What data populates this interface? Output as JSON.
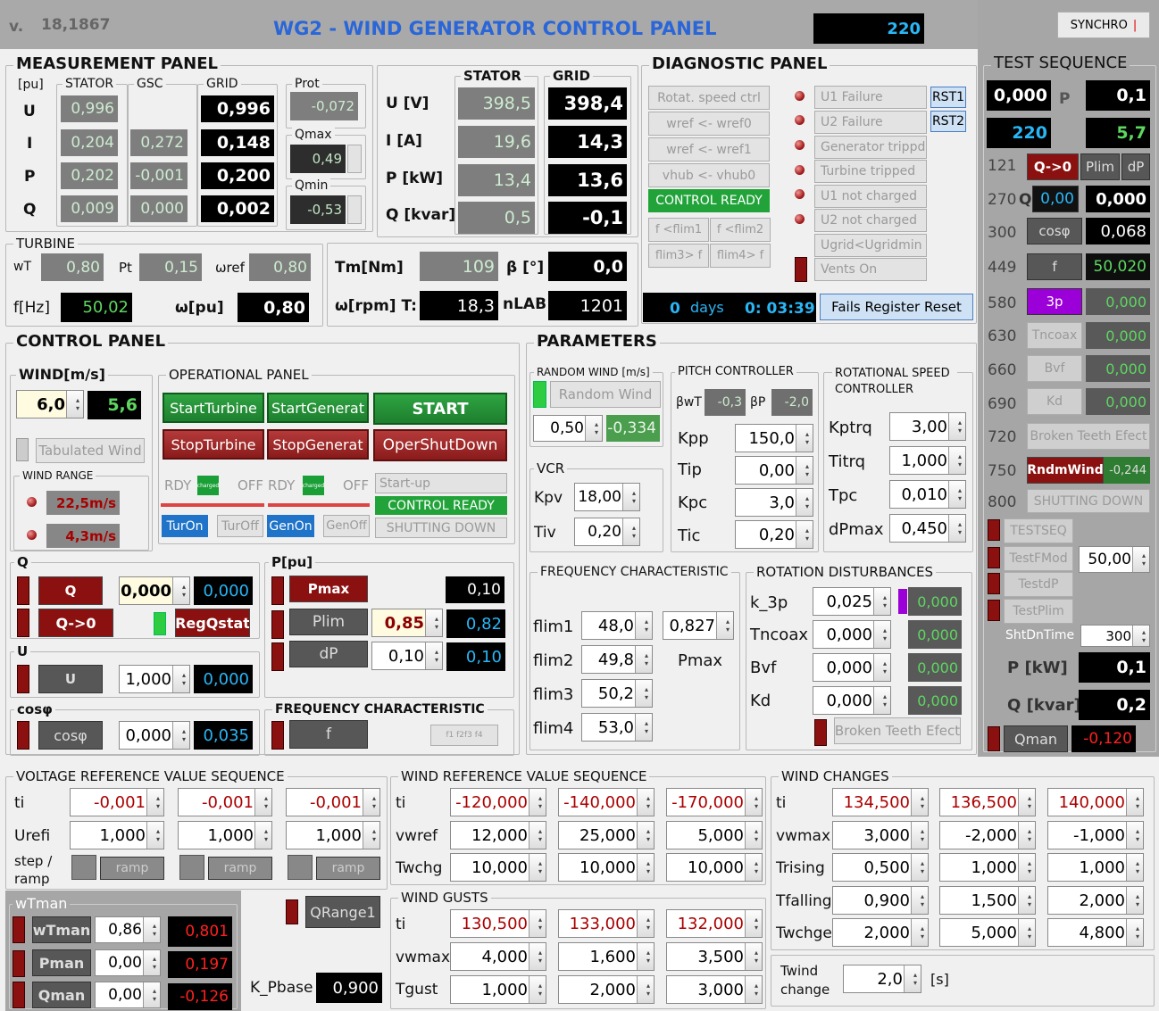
{
  "header": {
    "version": "v.",
    "version_num": "18,1867",
    "title": "WG2 - WIND GENERATOR CONTROL PANEL",
    "value": "220",
    "synchro": "SYNCHRO"
  },
  "meas": {
    "title": "MEASUREMENT PANEL",
    "pu": "[pu]",
    "stator": "STATOR",
    "gsc": "GSC",
    "grid": "GRID",
    "rows": [
      "U",
      "I",
      "P",
      "Q"
    ],
    "stator_vals": [
      "0,996",
      "0,204",
      "0,202",
      "0,009"
    ],
    "gsc_vals": [
      "",
      "0,272",
      "-0,001",
      "0,000"
    ],
    "grid_vals": [
      "0,996",
      "0,148",
      "0,200",
      "0,002"
    ],
    "prot": "Prot",
    "prot_val": "-0,072",
    "qmax": "Qmax",
    "qmax_val": "0,49",
    "qmin": "Qmin",
    "qmin_val": "-0,53"
  },
  "meas2": {
    "stator": "STATOR",
    "grid": "GRID",
    "labels": [
      "U [V]",
      "I [A]",
      "P [kW]",
      "Q [kvar]"
    ],
    "stator_vals": [
      "398,5",
      "19,6",
      "13,4",
      "0,5"
    ],
    "grid_vals": [
      "398,4",
      "14,3",
      "13,6",
      "-0,1"
    ]
  },
  "turbine": {
    "title": "TURBINE",
    "wt": "wT",
    "wt_val": "0,80",
    "pt": "Pt",
    "pt_val": "0,15",
    "wref": "ωref",
    "wref_val": "0,80",
    "fhz": "f[Hz]",
    "fhz_val": "50,02",
    "wpu": "ω[pu]",
    "wpu_val": "0,80",
    "tm": "Tm[Nm]",
    "tm_val": "109",
    "beta": "β [°]",
    "beta_val": "0,0",
    "wrpm": "ω[rpm] T:",
    "wrpm_val": "18,3",
    "nlab": "nLAB",
    "nlab_val": "1201"
  },
  "diag": {
    "title": "DIAGNOSTIC PANEL",
    "buttons": [
      "Rotat. speed ctrl",
      "wref <- wref0",
      "wref <- wref1",
      "vhub <- vhub0"
    ],
    "ready": "CONTROL READY",
    "flim": [
      "f <flim1",
      "f <flim2",
      "flim3> f",
      "flim4> f"
    ],
    "failures": [
      "U1 Failure",
      "U2 Failure",
      "Generator trippd",
      "Turbine tripped",
      "U1 not charged",
      "U2 not charged",
      "Ugrid<Ugridmin",
      "Vents On"
    ],
    "rst1": "RST1",
    "rst2": "RST2",
    "days_val": "0",
    "days": "days",
    "time": "0: 03:39",
    "fails_reset": "Fails Register Reset"
  },
  "test": {
    "title": "TEST SEQUENCE",
    "p": "P",
    "v1": "0,000",
    "v2": "0,1",
    "v3": "220",
    "v4": "5,7",
    "rows": [
      {
        "n": "121",
        "btn": "Q->0",
        "x1": "Plim",
        "x2": "dP"
      },
      {
        "n": "270",
        "q": "Q",
        "v": "0,00",
        "r": "0,000"
      },
      {
        "n": "300",
        "btn": "cosφ",
        "r": "0,068"
      },
      {
        "n": "449",
        "btn": "f",
        "r": "50,020"
      },
      {
        "n": "580",
        "btn": "3p",
        "r": "0,000"
      },
      {
        "n": "630",
        "btn": "Tncoax",
        "r": "0,000"
      },
      {
        "n": "660",
        "btn": "Bvf",
        "r": "0,000"
      },
      {
        "n": "690",
        "btn": "Kd",
        "r": "0,000"
      },
      {
        "n": "720",
        "btn": "Broken Teeth Efect"
      },
      {
        "n": "750",
        "btn": "RndmWind",
        "r": "-0,244"
      },
      {
        "n": "800",
        "btn": "SHUTTING DOWN"
      }
    ],
    "testseq": "TESTSEQ",
    "testfmod": "TestFMod",
    "testfmod_val": "50,00",
    "testdp": "TestdP",
    "testplim": "TestPlim",
    "shtdn": "ShtDnTime",
    "shtdn_val": "300",
    "pkw": "P [kW]",
    "pkw_val": "0,1",
    "qkvar": "Q [kvar]",
    "qkvar_val": "0,2",
    "qman": "Qman",
    "qman_val": "-0,120"
  },
  "control": {
    "title": "CONTROL PANEL",
    "wind": "WIND[m/s]",
    "wind_in": "6,0",
    "wind_val": "5,6",
    "tabulated": "Tabulated Wind",
    "wind_range": "WIND RANGE",
    "wr1": "22,5m/s",
    "wr2": "4,3m/s",
    "op": "OPERATIONAL PANEL",
    "startturbine": "StartTurbine",
    "startgen": "StartGenerat",
    "start": "START",
    "stopturbine": "StopTurbine",
    "stopgen": "StopGenerat",
    "opershut": "OperShutDown",
    "rdy": "RDY",
    "charged": "charged",
    "off": "OFF",
    "startup": "Start-up",
    "ctrlready": "CONTROL READY",
    "turon": "TurOn",
    "turoff": "TurOff",
    "genon": "GenOn",
    "genoff": "GenOff",
    "shutting": "SHUTTING DOWN",
    "q": "Q",
    "q_btn": "Q",
    "q_in": "0,000",
    "q_val": "0,000",
    "q0": "Q->0",
    "regq": "RegQstat",
    "u": "U",
    "u_btn": "U",
    "u_in": "1,000",
    "u_val": "0,000",
    "cos": "cosφ",
    "cos_btn": "cosφ",
    "cos_in": "0,000",
    "cos_val": "0,035",
    "ppu": "P[pu]",
    "pmax": "Pmax",
    "pmax_val": "0,10",
    "plim": "Plim",
    "plim_in": "0,85",
    "plim_val": "0,82",
    "dp": "dP",
    "dp_in": "0,10",
    "dp_val": "0,10",
    "freq": "FREQUENCY  CHARACTERISTIC",
    "f": "f",
    "fbtns": "f1 f2f3 f4"
  },
  "params": {
    "title": "PARAMETERS",
    "rw": "RANDOM WIND [m/s]",
    "rw_btn": "Random Wind",
    "rw_in": "0,50",
    "rw_val": "-0,334",
    "vcr": "VCR",
    "kpv": "Kpv",
    "kpv_val": "18,00",
    "tiv": "Tiv",
    "tiv_val": "0,20",
    "pitch": "PITCH CONTROLLER",
    "bwt": "βwT",
    "bwt_val": "-0,3",
    "bp": "βP",
    "bp_val": "-2,0",
    "kpp": "Kpp",
    "kpp_val": "150,0",
    "tip": "Tip",
    "tip_val": "0,00",
    "kpc": "Kpc",
    "kpc_val": "3,0",
    "tic": "Tic",
    "tic_val": "0,20",
    "rsc": "ROTATIONAL SPEED CONTROLLER",
    "kptrq": "Kptrq",
    "kptrq_val": "3,00",
    "titrq": "Titrq",
    "titrq_val": "1,000",
    "tpc": "Tpc",
    "tpc_val": "0,010",
    "dpmax": "dPmax",
    "dpmax_val": "0,450",
    "fc": "FREQUENCY CHARACTERISTIC",
    "flim1": "flim1",
    "flim1_val": "48,0",
    "flim2": "flim2",
    "flim2_val": "49,8",
    "flim3": "flim3",
    "flim3_val": "50,2",
    "flim4": "flim4",
    "flim4_val": "53,0",
    "pmax_in": "0,827",
    "pmax": "Pmax",
    "rd": "ROTATION DISTURBANCES",
    "k3p": "k_3p",
    "k3p_in": "0,025",
    "k3p_val": "0,000",
    "tncoax": "Tncoax",
    "tncoax_in": "0,000",
    "tncoax_val": "0,000",
    "bvf": "Bvf",
    "bvf_in": "0,000",
    "bvf_val": "0,000",
    "kd": "Kd",
    "kd_in": "0,000",
    "kd_val": "0,000",
    "broken": "Broken Teeth Efect"
  },
  "vrvs": {
    "title": "VOLTAGE REFERENCE VALUE SEQUENCE",
    "ti": "ti",
    "ti_vals": [
      "-0,001",
      "-0,001",
      "-0,001"
    ],
    "urefi": "Urefi",
    "urefi_vals": [
      "1,000",
      "1,000",
      "1,000"
    ],
    "step": "step /",
    "ramp_l": "ramp",
    "ramp": "ramp"
  },
  "wrvs": {
    "title": "WIND REFERENCE VALUE SEQUENCE",
    "ti": "ti",
    "ti_vals": [
      "-120,000",
      "-140,000",
      "-170,000"
    ],
    "vwref": "vwref",
    "vwref_vals": [
      "12,000",
      "25,000",
      "5,000"
    ],
    "twchg": "Twchg",
    "twchg_vals": [
      "10,000",
      "10,000",
      "10,000"
    ]
  },
  "gusts": {
    "title": "WIND GUSTS",
    "ti": "ti",
    "ti_vals": [
      "130,500",
      "133,000",
      "132,000"
    ],
    "vwmax": "vwmax",
    "vwmax_vals": [
      "4,000",
      "1,600",
      "3,500"
    ],
    "tgust": "Tgust",
    "tgust_vals": [
      "1,000",
      "2,000",
      "3,000"
    ]
  },
  "wc": {
    "title": "WIND CHANGES",
    "ti": "ti",
    "ti_vals": [
      "134,500",
      "136,500",
      "140,000"
    ],
    "vwmax": "vwmax",
    "vwmax_vals": [
      "3,000",
      "-2,000",
      "-1,000"
    ],
    "trising": "Trising",
    "trising_vals": [
      "0,500",
      "1,000",
      "1,000"
    ],
    "tfalling": "Tfalling",
    "tfalling_vals": [
      "0,900",
      "1,500",
      "2,000"
    ],
    "twchg": "Twchge",
    "twchg_vals": [
      "2,000",
      "5,000",
      "4,800"
    ],
    "twind1": "Twind",
    "twind2": "change",
    "twind_val": "2,0",
    "s": "[s]"
  },
  "wtman": {
    "title": "wTman",
    "rows": [
      {
        "btn": "wTman",
        "in": "0,86",
        "val": "0,801"
      },
      {
        "btn": "Pman",
        "in": "0,00",
        "val": "0,197"
      },
      {
        "btn": "Qman",
        "in": "0,00",
        "val": "-0,126"
      }
    ],
    "qrange": "QRange1",
    "kpbase": "K_Pbase",
    "kpbase_val": "0,900"
  }
}
